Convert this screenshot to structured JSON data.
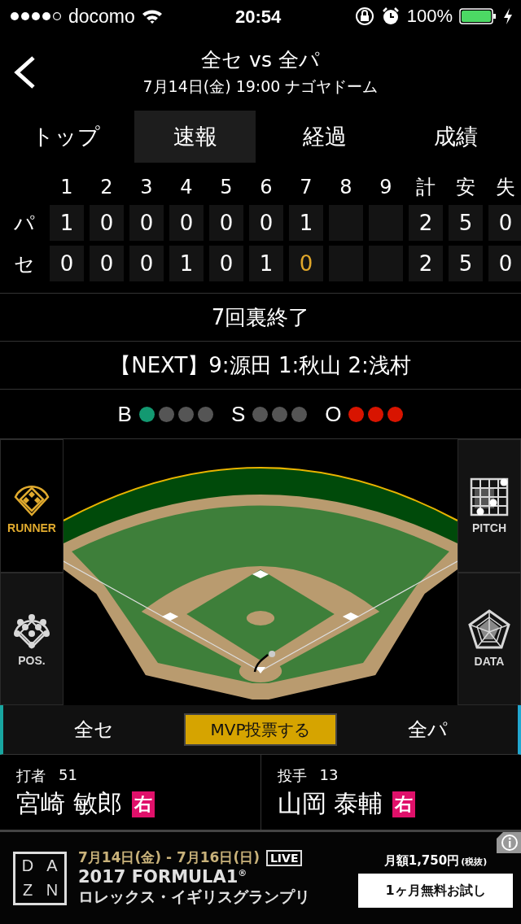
{
  "status_bar": {
    "carrier": "docomo",
    "time": "20:54",
    "battery": "100%"
  },
  "header": {
    "title": "全セ vs 全パ",
    "subtitle": "7月14日(金) 19:00 ナゴヤドーム"
  },
  "tabs": [
    {
      "label": "トップ",
      "selected": false
    },
    {
      "label": "速報",
      "selected": true
    },
    {
      "label": "経過",
      "selected": false
    },
    {
      "label": "成績",
      "selected": false
    }
  ],
  "scoreboard": {
    "columns": [
      "1",
      "2",
      "3",
      "4",
      "5",
      "6",
      "7",
      "8",
      "9",
      "計",
      "安",
      "失"
    ],
    "rows": [
      {
        "team": "パ",
        "cells": [
          {
            "value": "1",
            "current": false
          },
          {
            "value": "0",
            "current": false
          },
          {
            "value": "0",
            "current": false
          },
          {
            "value": "0",
            "current": false
          },
          {
            "value": "0",
            "current": false
          },
          {
            "value": "0",
            "current": false
          },
          {
            "value": "1",
            "current": false
          },
          {},
          {},
          {
            "value": "2",
            "current": false
          },
          {
            "value": "5",
            "current": false
          },
          {
            "value": "0",
            "current": false
          }
        ]
      },
      {
        "team": "セ",
        "cells": [
          {
            "value": "0",
            "current": false
          },
          {
            "value": "0",
            "current": false
          },
          {
            "value": "0",
            "current": false
          },
          {
            "value": "1",
            "current": false
          },
          {
            "value": "0",
            "current": false
          },
          {
            "value": "1",
            "current": false
          },
          {
            "value": "0",
            "current": true
          },
          {},
          {},
          {
            "value": "2",
            "current": false
          },
          {
            "value": "5",
            "current": false
          },
          {
            "value": "0",
            "current": false
          }
        ]
      }
    ]
  },
  "inning_status": "7回裏終了",
  "next_batters": "【NEXT】9:源田  1:秋山  2:浅村",
  "count": [
    {
      "label": "B",
      "kind": "ball",
      "dots": [
        {
          "on": true
        },
        {
          "on": false
        },
        {
          "on": false
        },
        {
          "on": false
        }
      ]
    },
    {
      "label": "S",
      "kind": "strike",
      "dots": [
        {
          "on": false
        },
        {
          "on": false
        },
        {
          "on": false
        }
      ]
    },
    {
      "label": "O",
      "kind": "out",
      "dots": [
        {
          "on": true
        },
        {
          "on": true
        },
        {
          "on": true
        }
      ]
    }
  ],
  "side_buttons": {
    "left": [
      {
        "label": "RUNNER",
        "kind": "runner",
        "selected": true
      },
      {
        "label": "POS.",
        "kind": "pos",
        "selected": false
      }
    ],
    "right": [
      {
        "label": "PITCH",
        "kind": "pitch",
        "selected": false
      },
      {
        "label": "DATA",
        "kind": "data",
        "selected": false
      }
    ]
  },
  "teams_bar": {
    "home": "全セ",
    "mvp_button": "MVP投票する",
    "away": "全パ"
  },
  "players": [
    {
      "role": "打者",
      "number": "51",
      "name": "宮崎 敏郎",
      "hand": "右"
    },
    {
      "role": "投手",
      "number": "13",
      "name": "山岡 泰輔",
      "hand": "右"
    }
  ],
  "ad": {
    "logo_letters": [
      "D",
      "A",
      "Z",
      "N"
    ],
    "dates": "7月14日(金) - 7月16日(日)",
    "live_badge": "LIVE",
    "title": "2017 FORMULA1$^{®}$",
    "subtitle": "ロレックス・イギリスグランプリ",
    "price": "月額1,750円",
    "price_note": "(税抜)",
    "cta": "1ヶ月無料お試し"
  }
}
